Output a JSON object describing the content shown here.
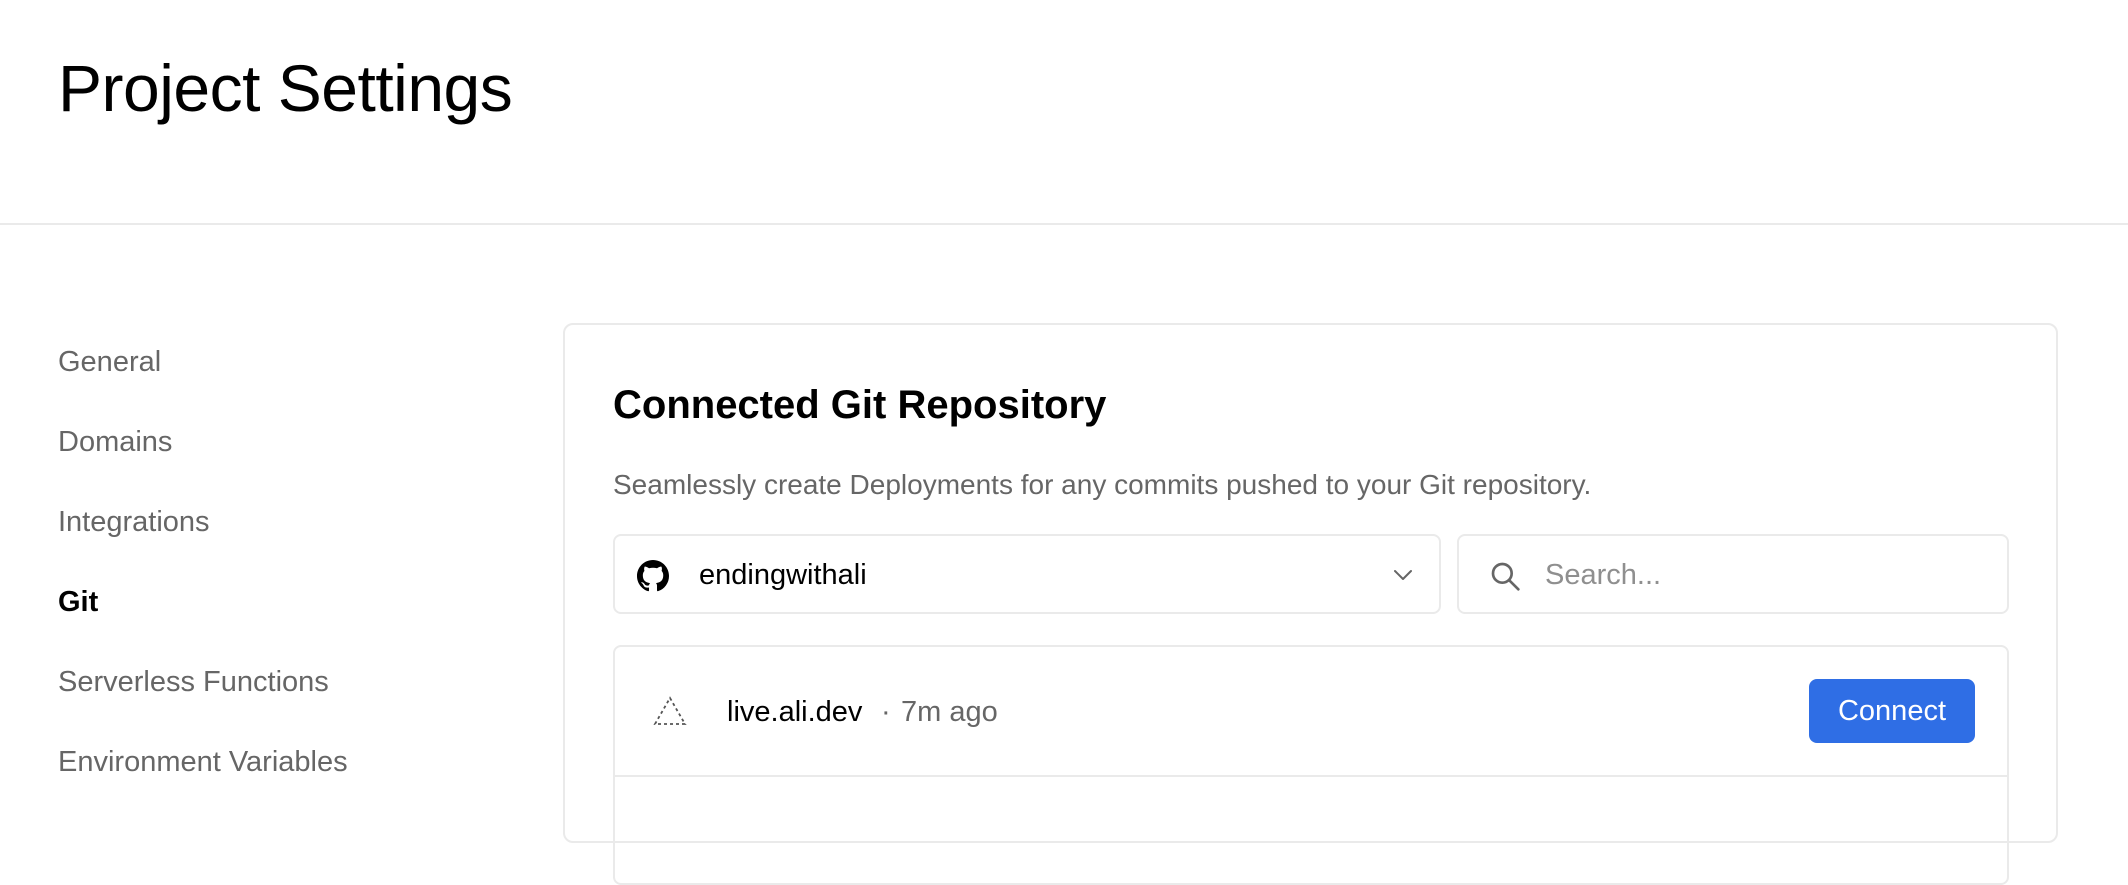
{
  "header": {
    "title": "Project Settings"
  },
  "sidebar": {
    "items": [
      {
        "label": "General",
        "active": false
      },
      {
        "label": "Domains",
        "active": false
      },
      {
        "label": "Integrations",
        "active": false
      },
      {
        "label": "Git",
        "active": true
      },
      {
        "label": "Serverless Functions",
        "active": false
      },
      {
        "label": "Environment Variables",
        "active": false
      }
    ]
  },
  "git_card": {
    "title": "Connected Git Repository",
    "description": "Seamlessly create Deployments for any commits pushed to your Git repository.",
    "account_select": {
      "value": "endingwithali",
      "icon": "github-icon"
    },
    "search": {
      "placeholder": "Search...",
      "value": ""
    },
    "repositories": [
      {
        "name": "live.ali.dev",
        "separator": "·",
        "updated": "7m ago",
        "icon": "triangle-dashed-icon",
        "action_label": "Connect"
      }
    ]
  },
  "colors": {
    "accent": "#2f6ee5",
    "border": "#eaeaea",
    "muted_text": "#666666",
    "text": "#000000"
  }
}
